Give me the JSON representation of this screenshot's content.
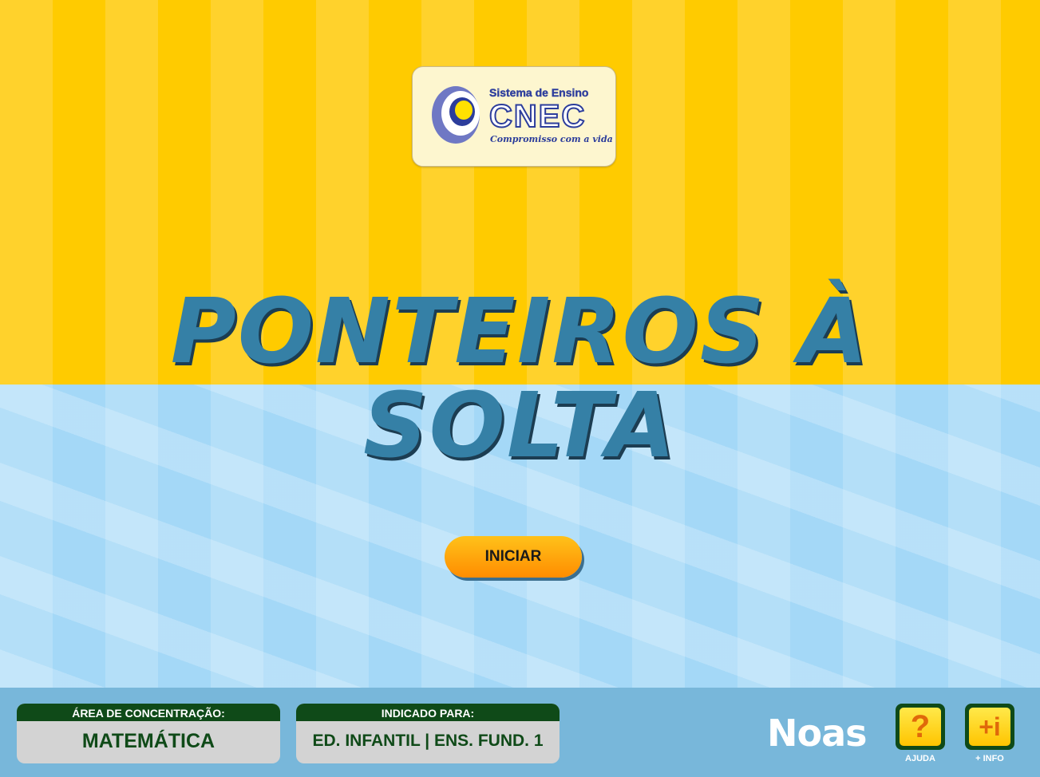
{
  "logo": {
    "top_text": "Sistema de Ensino",
    "main_text": "CNEC",
    "slogan": "Compromisso com a vida"
  },
  "title": {
    "line1": "PONTEIROS À",
    "line2": "SOLTA"
  },
  "start_button": {
    "label": "INICIAR"
  },
  "footer": {
    "area": {
      "header": "ÁREA DE CONCENTRAÇÃO:",
      "value": "MATEMÁTICA"
    },
    "indicated": {
      "header": "INDICADO PARA:",
      "value": "ED. INFANTIL | ENS. FUND. 1"
    },
    "brand": "Noas",
    "help": {
      "icon": "?",
      "label": "AJUDA"
    },
    "info": {
      "icon": "+i",
      "label": "+ INFO"
    }
  },
  "colors": {
    "top_stripe_light": "#ffd22c",
    "top_stripe_dark": "#ffcb00",
    "bottom_bg": "#a4d8f7",
    "title": "#3580a6",
    "footer_bg": "#78b7da",
    "card_header": "#0f4a18",
    "button_orange": "#ff8c00"
  }
}
